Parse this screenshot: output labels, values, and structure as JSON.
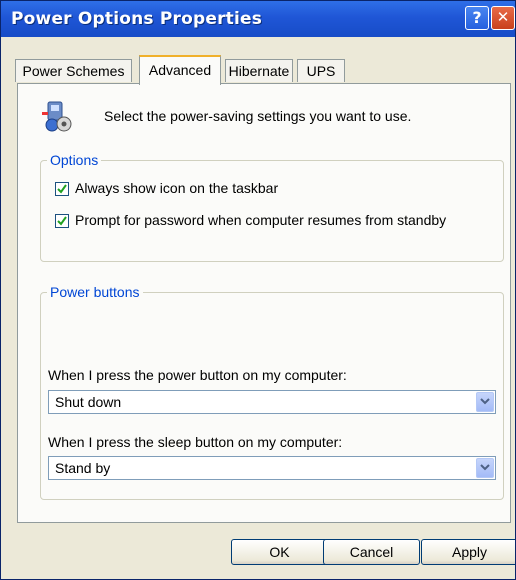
{
  "window": {
    "title": "Power Options Properties"
  },
  "tabs": [
    {
      "label": "Power Schemes"
    },
    {
      "label": "Advanced"
    },
    {
      "label": "Hibernate"
    },
    {
      "label": "UPS"
    }
  ],
  "header": {
    "text": "Select the power-saving settings you want to use."
  },
  "options": {
    "legend": "Options",
    "items": [
      {
        "label": "Always show icon on the taskbar",
        "checked": true
      },
      {
        "label": "Prompt for password when computer resumes from standby",
        "checked": true
      }
    ]
  },
  "power_buttons": {
    "legend": "Power buttons",
    "power_label": "When I press the power button on my computer:",
    "power_value": "Shut down",
    "sleep_label": "When I press the sleep button on my computer:",
    "sleep_value": "Stand by"
  },
  "buttons": {
    "ok": "OK",
    "cancel": "Cancel",
    "apply": "Apply"
  },
  "icons": {
    "help": "help-icon",
    "close": "close-icon",
    "header": "power-settings-icon",
    "dropdown": "chevron-down-icon"
  }
}
